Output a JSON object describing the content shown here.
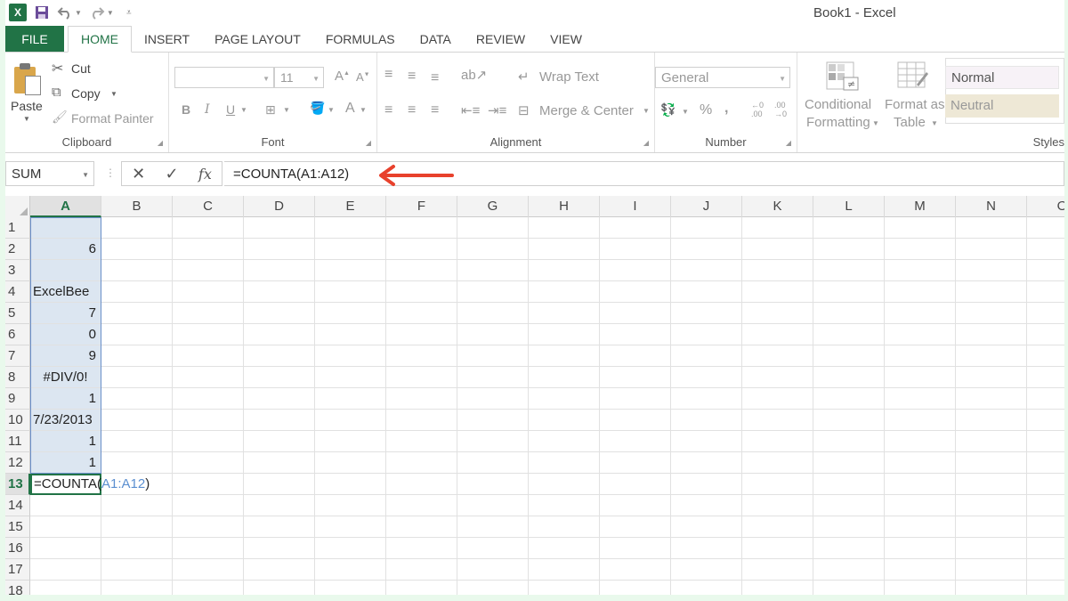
{
  "app": {
    "title": "Book1 - Excel",
    "logo": "X"
  },
  "qat": [
    "save-icon",
    "undo-icon",
    "redo-icon",
    "customize-icon"
  ],
  "tabs": [
    "FILE",
    "HOME",
    "INSERT",
    "PAGE LAYOUT",
    "FORMULAS",
    "DATA",
    "REVIEW",
    "VIEW"
  ],
  "clipboard": {
    "paste": "Paste",
    "cut": "Cut",
    "copy": "Copy",
    "format_painter": "Format Painter",
    "label": "Clipboard"
  },
  "font": {
    "size": "11",
    "label": "Font"
  },
  "alignment": {
    "wrap": "Wrap Text",
    "merge": "Merge & Center",
    "label": "Alignment"
  },
  "number": {
    "format": "General",
    "label": "Number"
  },
  "styles": {
    "cond1": "Conditional",
    "cond2": "Formatting",
    "fmt1": "Format as",
    "fmt2": "Table",
    "normal": "Normal",
    "neutral": "Neutral",
    "label": "Styles"
  },
  "formula_bar": {
    "name_box": "SUM",
    "formula": "=COUNTA(A1:A12)",
    "fx": "fx"
  },
  "columns": [
    "A",
    "B",
    "C",
    "D",
    "E",
    "F",
    "G",
    "H",
    "I",
    "J",
    "K",
    "L",
    "M",
    "N",
    "O"
  ],
  "rows": [
    "1",
    "2",
    "3",
    "4",
    "5",
    "6",
    "7",
    "8",
    "9",
    "10",
    "11",
    "12",
    "13",
    "14",
    "15",
    "16",
    "17",
    "18"
  ],
  "cells": {
    "A1": "",
    "A2": "6",
    "A3": "",
    "A4": "ExcelBee",
    "A5": "7",
    "A6": "0",
    "A7": "9",
    "A8": "#DIV/0!",
    "A9": "1",
    "A10": "7/23/2013",
    "A11": "1",
    "A12": "1"
  },
  "active_cell": {
    "func": "=COUNTA(",
    "ref": "A1:A12",
    "close": ")"
  },
  "colors": {
    "accent": "#217346",
    "selection": "#dce6f1",
    "arrow": "#e8412c",
    "ref": "#5b8fd0"
  }
}
